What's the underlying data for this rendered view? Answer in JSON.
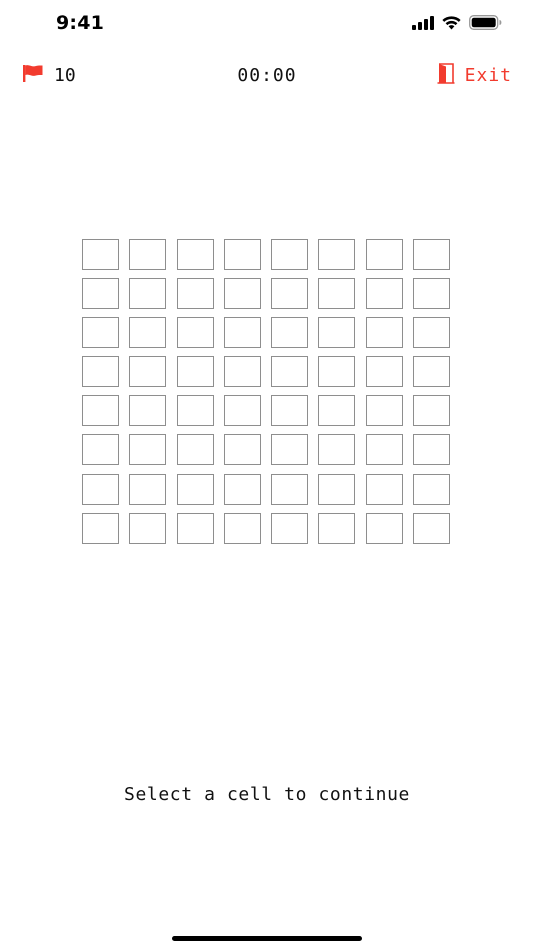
{
  "status_bar": {
    "time": "9:41",
    "icons": [
      "cellular-signal-icon",
      "wifi-icon",
      "battery-icon"
    ]
  },
  "header": {
    "flag_icon": "flag-icon",
    "flag_count": "10",
    "timer": "00:00",
    "exit_icon": "door-icon",
    "exit_label": "Exit"
  },
  "board": {
    "rows": 8,
    "columns": 8
  },
  "instruction": "Select a cell to continue",
  "colors": {
    "accent": "#f23b2e",
    "cell_border": "#8e8e8e",
    "text": "#111111",
    "background": "#ffffff"
  }
}
